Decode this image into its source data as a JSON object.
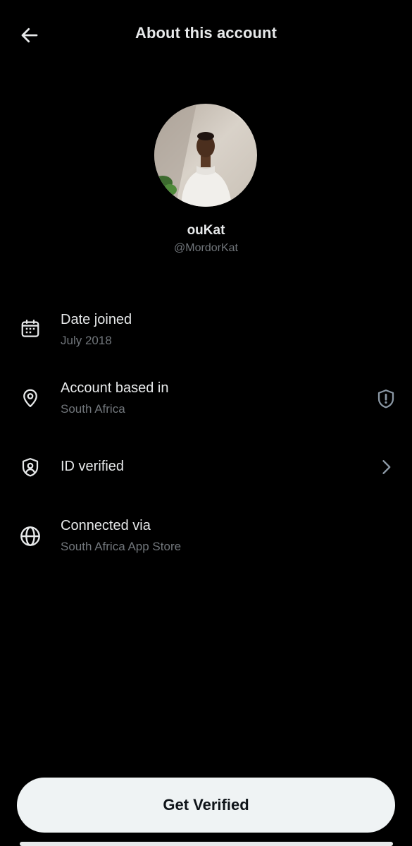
{
  "header": {
    "title": "About this account",
    "back_icon": "arrow-left-icon"
  },
  "profile": {
    "display_name": "ouKat",
    "handle": "@MordorKat"
  },
  "rows": [
    {
      "icon": "calendar-icon",
      "label": "Date joined",
      "value": "July 2018"
    },
    {
      "icon": "location-pin-icon",
      "label": "Account based in",
      "value": "South Africa",
      "trailing_icon": "shield-alert-icon"
    },
    {
      "icon": "id-verified-shield-icon",
      "label": "ID verified",
      "trailing_icon": "chevron-right-icon"
    },
    {
      "icon": "globe-icon",
      "label": "Connected via",
      "value": "South Africa App Store"
    }
  ],
  "cta": {
    "label": "Get Verified"
  },
  "colors": {
    "background": "#000000",
    "primary_text": "#e7e9ea",
    "secondary_text": "#71767b",
    "button_bg": "#eff3f4",
    "button_text": "#0f1419"
  }
}
